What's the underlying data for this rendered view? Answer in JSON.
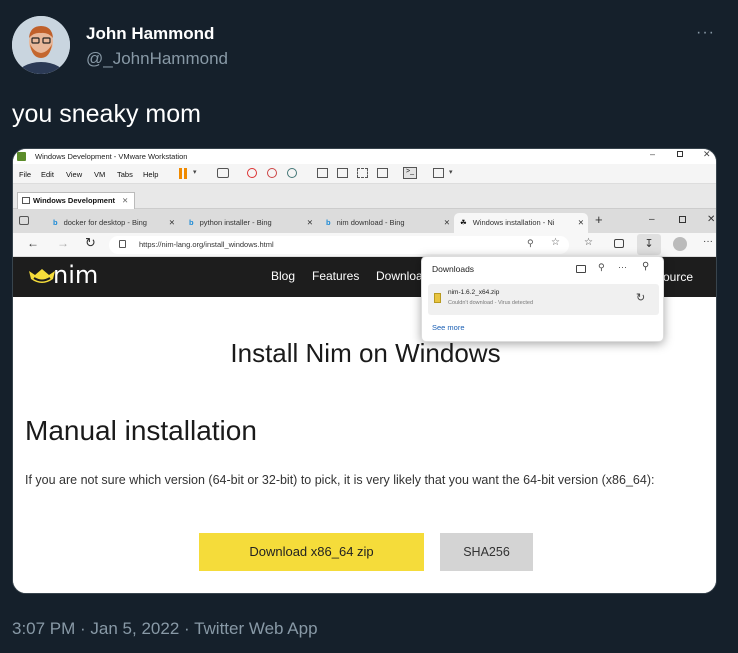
{
  "tweet": {
    "author_name": "John Hammond",
    "handle": "@_JohnHammond",
    "more_icon": "···",
    "text": "you sneaky mom",
    "timestamp": "3:07 PM · Jan 5, 2022 · Twitter Web App"
  },
  "vmware": {
    "title": "Windows Development - VMware Workstation",
    "menu": [
      "File",
      "Edit",
      "View",
      "VM",
      "Tabs",
      "Help"
    ],
    "tab_label": "Windows Development"
  },
  "edge": {
    "tabs": [
      {
        "label": "docker for desktop - Bing"
      },
      {
        "label": "python installer - Bing"
      },
      {
        "label": "nim download - Bing"
      },
      {
        "label": "Windows installation - Ni"
      }
    ],
    "url": "https://nim-lang.org/install_windows.html"
  },
  "nim_site": {
    "logo_text": "nim",
    "nav": [
      "Blog",
      "Features",
      "Download",
      "Source"
    ],
    "heading": "Install Nim on Windows",
    "subheading": "Manual installation",
    "paragraph": "If you are not sure which version (64-bit or 32-bit) to pick, it is very likely that you want the 64-bit version (x86_64):",
    "download_button": "Download x86_64 zip",
    "sha_button": "SHA256"
  },
  "downloads_panel": {
    "title": "Downloads",
    "file_name": "nim-1.6.2_x64.zip",
    "status": "Couldn't download - Virus detected",
    "see_more": "See more"
  },
  "colors": {
    "twitter_bg": "#15202b",
    "muted_text": "#8899a6",
    "nim_yellow": "#f5dc3a",
    "link_blue": "#1a5fb4"
  }
}
